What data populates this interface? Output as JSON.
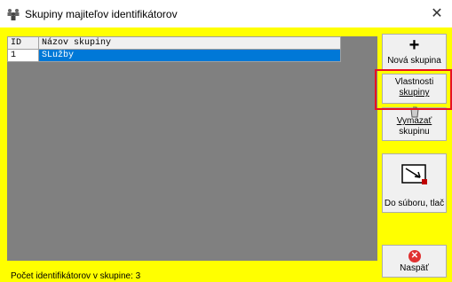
{
  "window": {
    "title": "Skupiny majiteľov identifikátorov",
    "close_glyph": "✕"
  },
  "table": {
    "columns": [
      "ID",
      "Názov skupiny"
    ],
    "rows": [
      {
        "id": "1",
        "name": "SLužby",
        "selected": true
      }
    ]
  },
  "buttons": {
    "new": {
      "label": "Nová skupina",
      "icon": "plus-icon"
    },
    "properties": {
      "line1": "Vlastnosti",
      "line2": "skupiny"
    },
    "delete": {
      "line1": "Vymazať",
      "line2": "skupinu",
      "icon": "trash-icon"
    },
    "export": {
      "label": "Do súboru, tlač",
      "icon": "export-icon"
    },
    "back": {
      "label": "Naspäť",
      "icon": "close-circle-icon"
    }
  },
  "status": {
    "text": "Počet identifikátorov v skupine: 3"
  },
  "colors": {
    "background": "#ffff00",
    "grid_bg": "#808080",
    "selection": "#0078d7",
    "highlight_frame": "#e81123"
  }
}
